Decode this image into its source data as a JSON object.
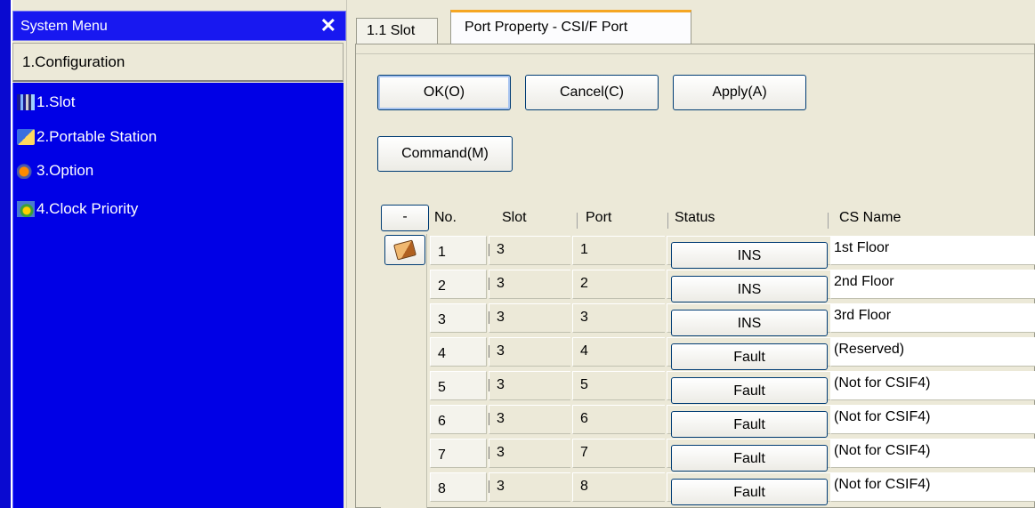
{
  "system_menu": {
    "title": "System Menu",
    "close_glyph": "✕",
    "category": "1.Configuration",
    "items": [
      {
        "label": "1.Slot",
        "icon": "slot-icon"
      },
      {
        "label": "2.Portable Station",
        "icon": "portable-station-icon"
      },
      {
        "label": "3.Option",
        "icon": "option-icon"
      },
      {
        "label": "4.Clock Priority",
        "icon": "clock-priority-icon"
      }
    ]
  },
  "tabs": [
    {
      "label": "1.1 Slot",
      "active": false
    },
    {
      "label": "Port Property - CSI/F Port",
      "active": true
    }
  ],
  "buttons": {
    "ok": "OK(O)",
    "cancel": "Cancel(C)",
    "apply": "Apply(A)",
    "command": "Command(M)"
  },
  "grid": {
    "collapse_label": "-",
    "columns": [
      "No.",
      "Slot",
      "Port",
      "Status",
      "CS Name"
    ],
    "rows": [
      {
        "no": "1",
        "slot": "3",
        "port": "1",
        "status": "INS",
        "cs_name": "1st Floor"
      },
      {
        "no": "2",
        "slot": "3",
        "port": "2",
        "status": "INS",
        "cs_name": "2nd Floor"
      },
      {
        "no": "3",
        "slot": "3",
        "port": "3",
        "status": "INS",
        "cs_name": "3rd Floor"
      },
      {
        "no": "4",
        "slot": "3",
        "port": "4",
        "status": "Fault",
        "cs_name": "(Reserved)"
      },
      {
        "no": "5",
        "slot": "3",
        "port": "5",
        "status": "Fault",
        "cs_name": "(Not for CSIF4)"
      },
      {
        "no": "6",
        "slot": "3",
        "port": "6",
        "status": "Fault",
        "cs_name": "(Not for CSIF4)"
      },
      {
        "no": "7",
        "slot": "3",
        "port": "7",
        "status": "Fault",
        "cs_name": "(Not for CSIF4)"
      },
      {
        "no": "8",
        "slot": "3",
        "port": "8",
        "status": "Fault",
        "cs_name": "(Not for CSIF4)"
      }
    ]
  }
}
